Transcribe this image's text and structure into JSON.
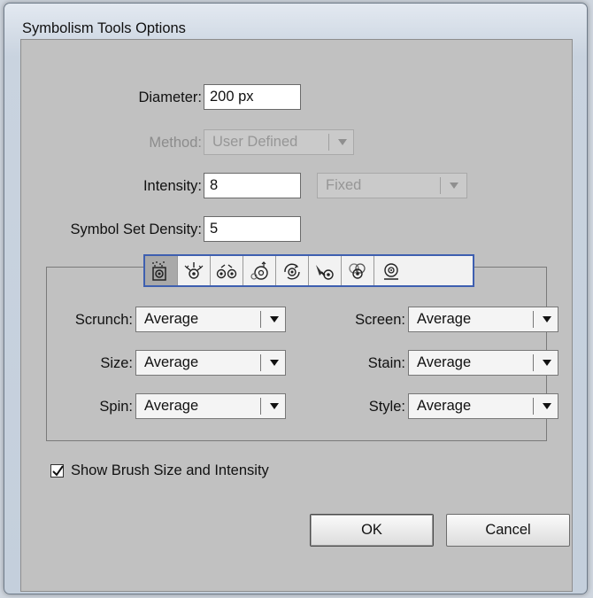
{
  "window": {
    "title": "Symbolism Tools Options"
  },
  "fields": {
    "diameter": {
      "label": "Diameter:",
      "value": "200 px"
    },
    "method": {
      "label": "Method:",
      "value": "User Defined"
    },
    "intensity": {
      "label": "Intensity:",
      "value": "8",
      "mode": "Fixed"
    },
    "density": {
      "label": "Symbol Set Density:",
      "value": "5"
    }
  },
  "tools": [
    {
      "icon": "symbol-sprayer-icon",
      "active": true
    },
    {
      "icon": "symbol-shifter-icon",
      "active": false
    },
    {
      "icon": "symbol-scruncher-icon",
      "active": false
    },
    {
      "icon": "symbol-sizer-icon",
      "active": false
    },
    {
      "icon": "symbol-spinner-icon",
      "active": false
    },
    {
      "icon": "symbol-stainer-icon",
      "active": false
    },
    {
      "icon": "symbol-screener-icon",
      "active": false
    },
    {
      "icon": "symbol-styler-icon",
      "active": false
    }
  ],
  "options": {
    "scrunch": {
      "label": "Scrunch:",
      "value": "Average"
    },
    "size": {
      "label": "Size:",
      "value": "Average"
    },
    "spin": {
      "label": "Spin:",
      "value": "Average"
    },
    "screen": {
      "label": "Screen:",
      "value": "Average"
    },
    "stain": {
      "label": "Stain:",
      "value": "Average"
    },
    "style": {
      "label": "Style:",
      "value": "Average"
    }
  },
  "show_brush": {
    "label": "Show Brush Size and Intensity",
    "checked": true
  },
  "buttons": {
    "ok": "OK",
    "cancel": "Cancel"
  }
}
